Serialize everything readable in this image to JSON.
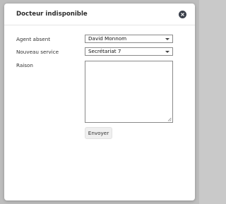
{
  "dialog": {
    "title": "Docteur indisponible"
  },
  "form": {
    "agent_label": "Agent absent",
    "agent_value": "David Monnom",
    "service_label": "Nouveau service",
    "service_value": "Secrétariat 7",
    "reason_label": "Raison",
    "reason_value": "",
    "submit_label": "Envoyer"
  },
  "icons": {
    "close": "close-icon",
    "dropdown": "chevron-down-icon"
  },
  "colors": {
    "close_button_bg": "#3a3f4a",
    "backdrop": "#bdbdbd"
  }
}
